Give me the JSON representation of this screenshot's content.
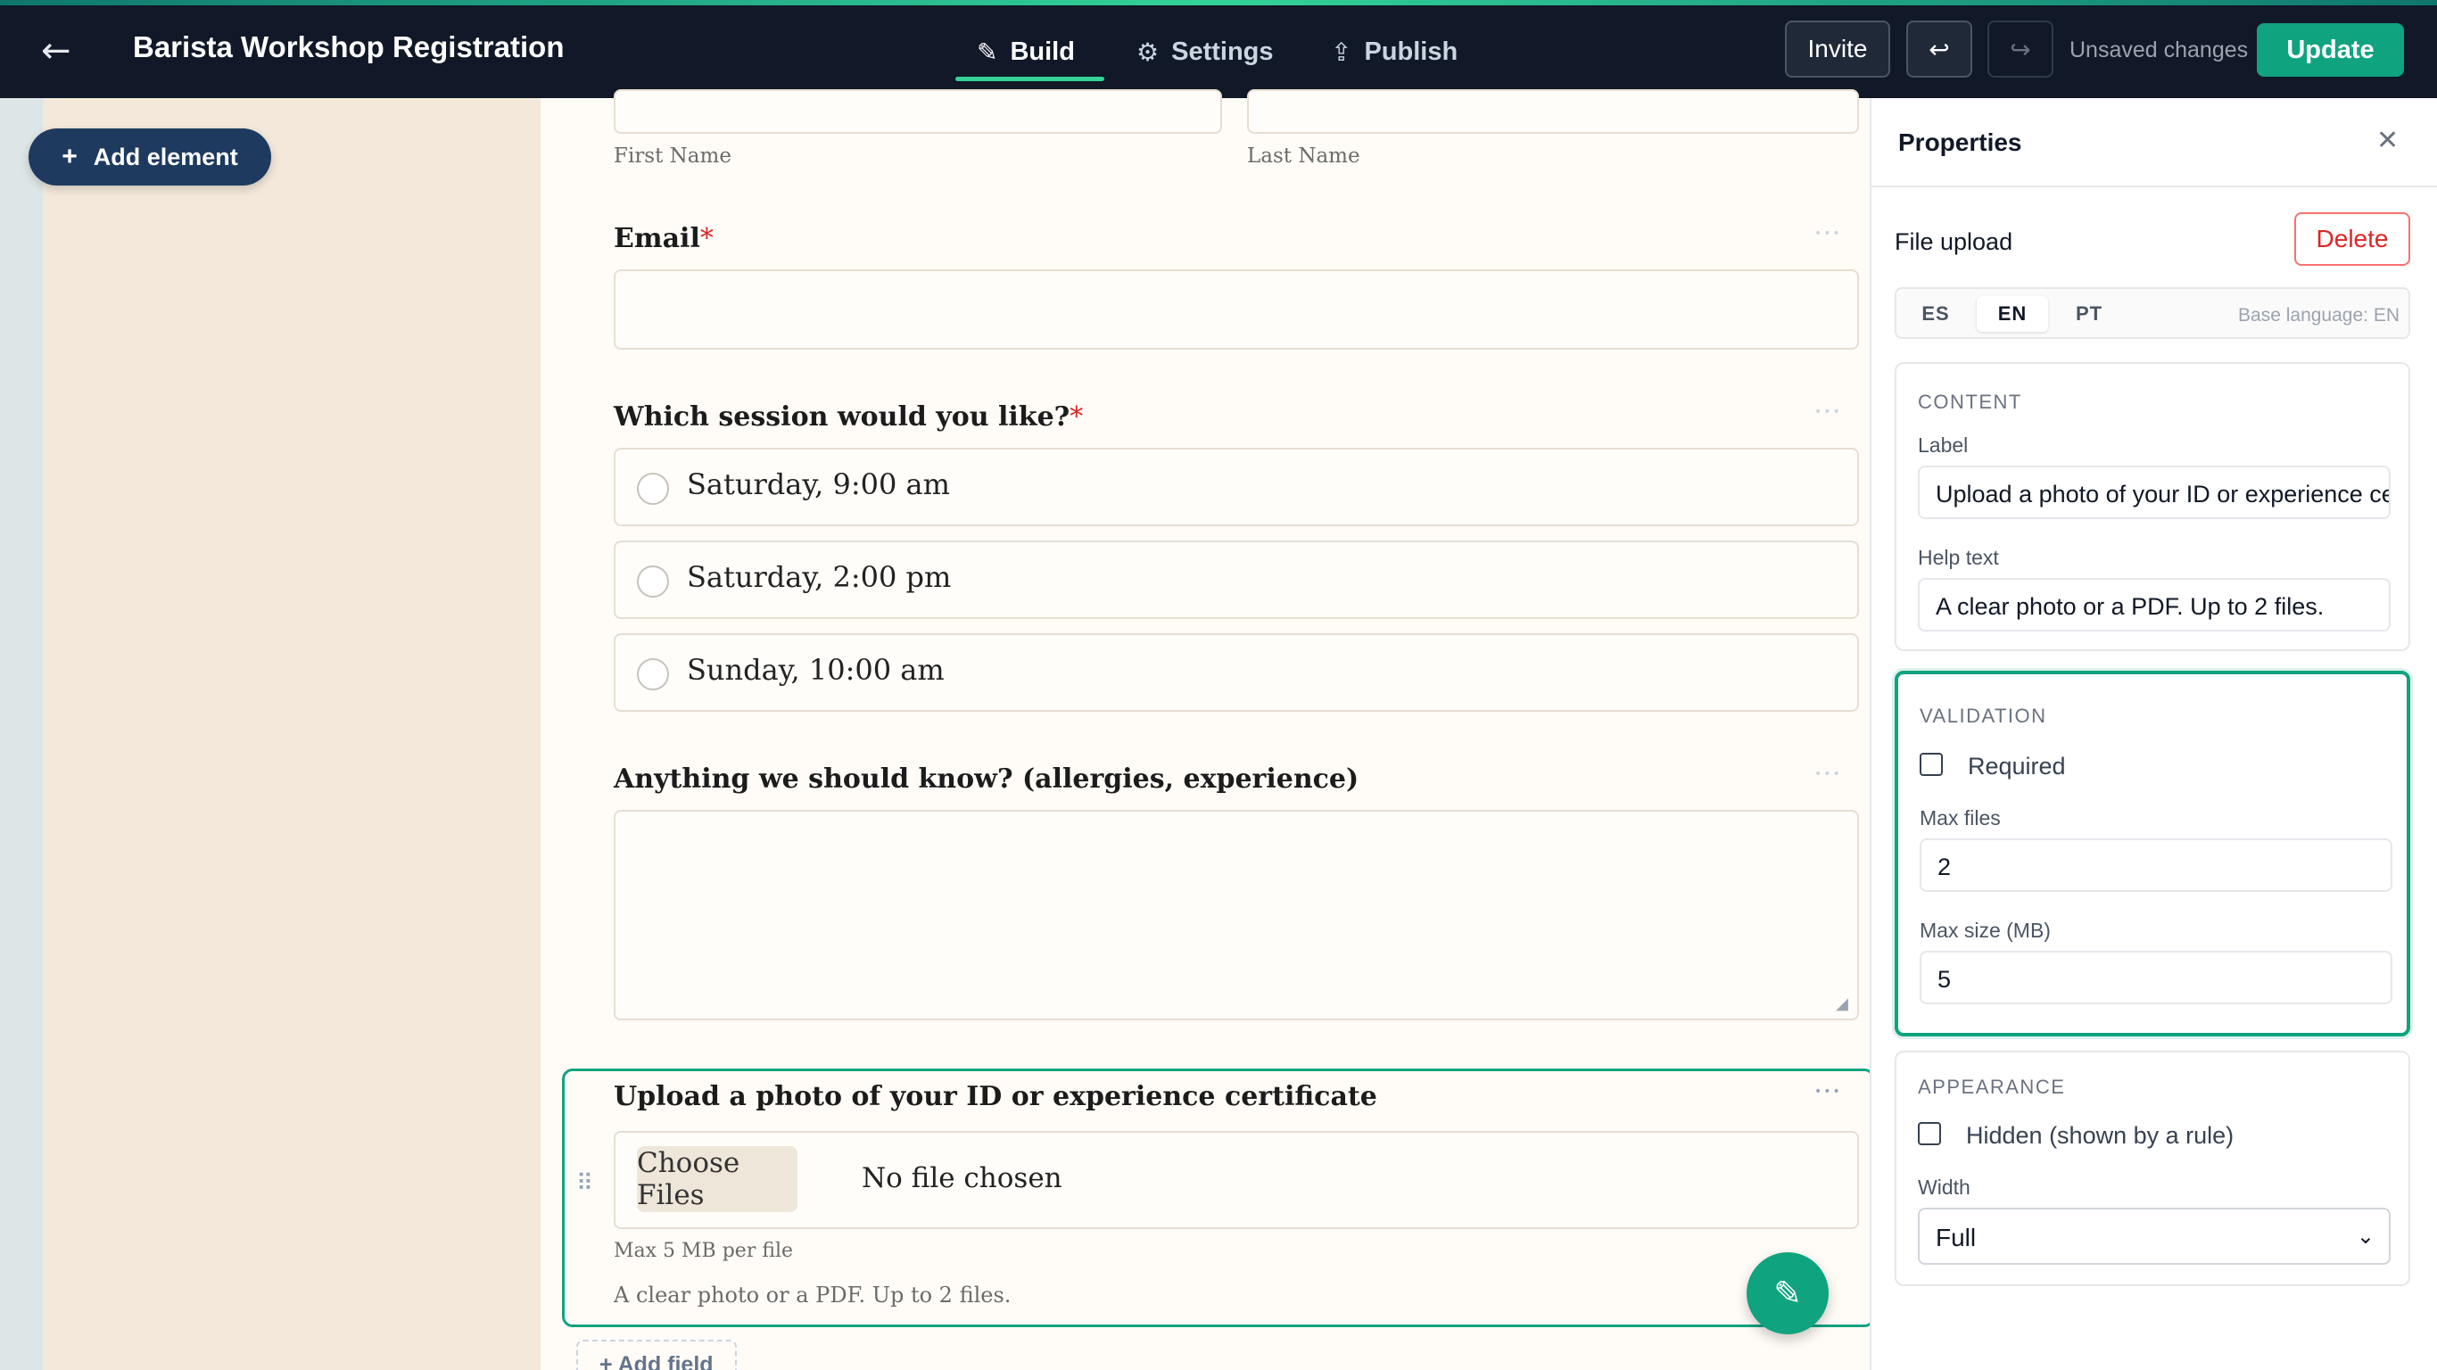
{
  "header": {
    "back_icon": "←",
    "title": "Barista Workshop Registration",
    "tabs": [
      {
        "label": "Build",
        "icon": "✎"
      },
      {
        "label": "Settings",
        "icon": "⚙"
      },
      {
        "label": "Publish",
        "icon": "⇪"
      }
    ],
    "invite_label": "Invite",
    "undo_icon": "↩",
    "redo_icon": "↪",
    "status": "Unsaved changes",
    "update_label": "Update"
  },
  "sidebar": {
    "add_element_icon": "+",
    "add_element_label": "Add element"
  },
  "form": {
    "name_sublabels": {
      "first": "First Name",
      "last": "Last Name"
    },
    "email": {
      "label": "Email",
      "required_mark": "*"
    },
    "session": {
      "label": "Which session would you like?",
      "required_mark": "*",
      "options": [
        "Saturday, 9:00 am",
        "Saturday, 2:00 pm",
        "Sunday, 10:00 am"
      ]
    },
    "notes": {
      "label": "Anything we should know? (allergies, experience)"
    },
    "upload": {
      "label": "Upload a photo of your ID or experience certificate",
      "choose_files": "Choose Files",
      "no_file": "No file chosen",
      "max_note": "Max 5 MB per file",
      "help": "A clear photo or a PDF. Up to 2 files."
    },
    "drag_icon": "⠿",
    "more_icon": "•••",
    "edit_icon": "✎",
    "add_field_label": "+ Add field"
  },
  "properties": {
    "title": "Properties",
    "close_icon": "✕",
    "element_type": "File upload",
    "delete_label": "Delete",
    "languages": [
      "ES",
      "EN",
      "PT"
    ],
    "active_language": "EN",
    "base_language": "Base language: EN",
    "content": {
      "section": "CONTENT",
      "label_label": "Label",
      "label_value": "Upload a photo of your ID or experience certificate",
      "help_label": "Help text",
      "help_value": "A clear photo or a PDF. Up to 2 files."
    },
    "validation": {
      "section": "VALIDATION",
      "required_label": "Required",
      "required_checked": false,
      "max_files_label": "Max files",
      "max_files_value": "2",
      "max_size_label": "Max size (MB)",
      "max_size_value": "5"
    },
    "appearance": {
      "section": "APPEARANCE",
      "hidden_label": "Hidden (shown by a rule)",
      "hidden_checked": false,
      "width_label": "Width",
      "width_value": "Full"
    }
  },
  "colors": {
    "accent": "#10a37f",
    "header_bg": "#111827",
    "canvas_bg": "#f3e8da",
    "required": "#dc2626"
  }
}
